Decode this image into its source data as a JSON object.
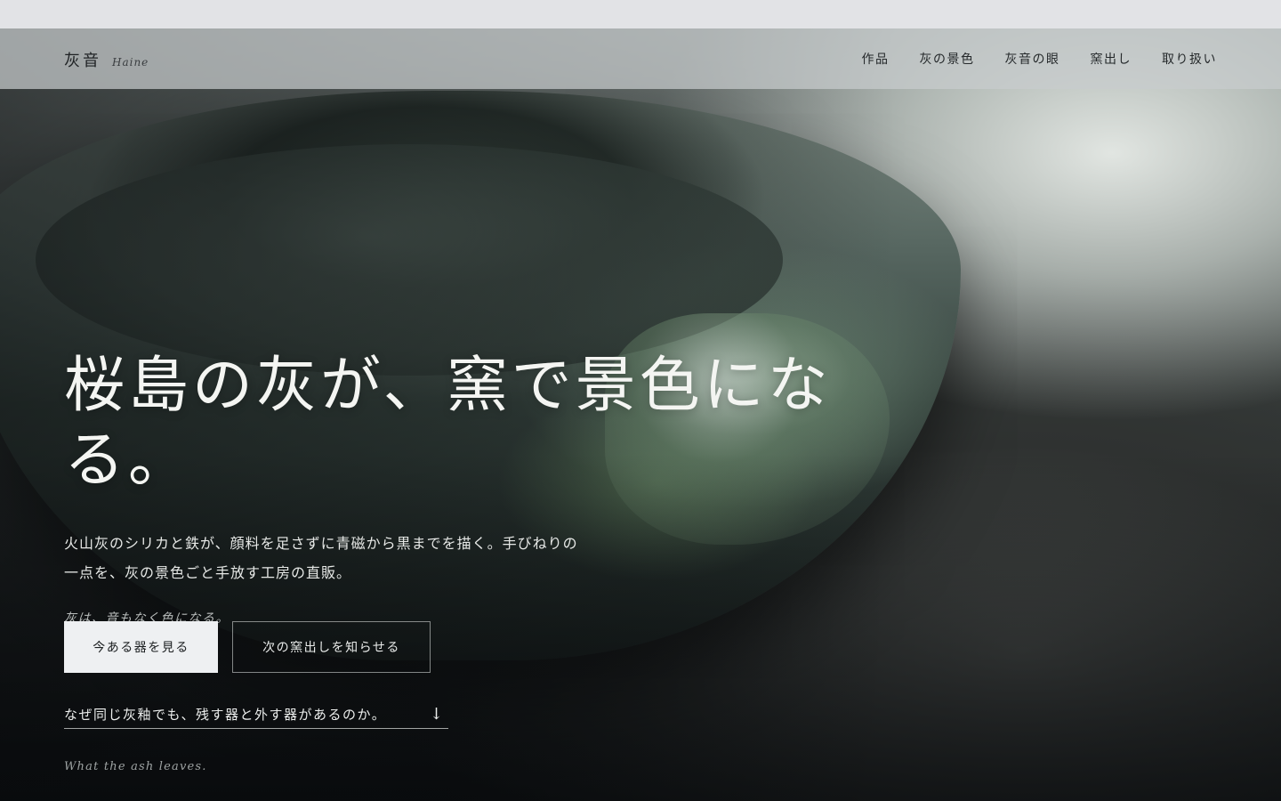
{
  "brand": {
    "name_jp": "灰音",
    "name_en": "Haine"
  },
  "nav": {
    "items": [
      {
        "label": "作品"
      },
      {
        "label": "灰の景色"
      },
      {
        "label": "灰音の眼"
      },
      {
        "label": "窯出し"
      },
      {
        "label": "取り扱い"
      }
    ]
  },
  "hero": {
    "headline": "桜島の灰が、窯で景色になる。",
    "lead": "火山灰のシリカと鉄が、顔料を足さずに青磁から黒までを描く。手びねりの一点を、灰の景色ごと手放す工房の直販。",
    "tagline": "灰は、音もなく色になる。",
    "primary_cta": "今ある器を見る",
    "secondary_cta": "次の窯出しを知らせる",
    "question_link": "なぜ同じ灰釉でも、残す器と外す器があるのか。",
    "arrow_icon": "arrow-down-icon",
    "footer_note": "What the ash leaves."
  },
  "colors": {
    "nav_bg": "#c8cccd",
    "primary_btn_bg": "#eef0f2",
    "text_light": "#f4f5f2",
    "text_dark": "#1f2224"
  }
}
